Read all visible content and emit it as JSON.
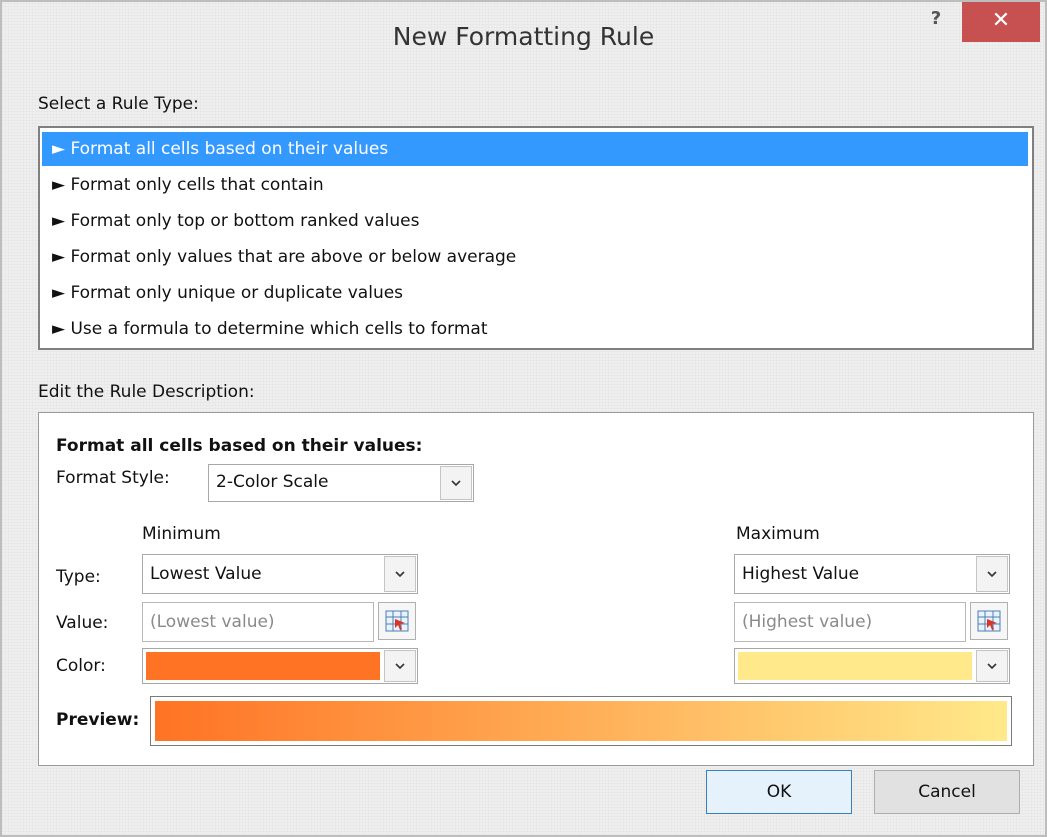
{
  "dialog": {
    "title": "New Formatting Rule",
    "help_label": "?",
    "close_label": "✕"
  },
  "rule_type": {
    "label": "Select a Rule Type:",
    "items": [
      {
        "label": "► Format all cells based on their values",
        "selected": true
      },
      {
        "label": "► Format only cells that contain",
        "selected": false
      },
      {
        "label": "► Format only top or bottom ranked values",
        "selected": false
      },
      {
        "label": "► Format only values that are above or below average",
        "selected": false
      },
      {
        "label": "► Format only unique or duplicate values",
        "selected": false
      },
      {
        "label": "► Use a formula to determine which cells to format",
        "selected": false
      }
    ]
  },
  "description": {
    "label": "Edit the Rule Description:",
    "heading": "Format all cells based on their values:",
    "format_style_label": "Format Style:",
    "format_style_value": "2-Color Scale",
    "minimum_header": "Minimum",
    "maximum_header": "Maximum",
    "type_label": "Type:",
    "value_label": "Value:",
    "color_label": "Color:",
    "min_type": "Lowest Value",
    "max_type": "Highest Value",
    "min_value_placeholder": "(Lowest value)",
    "max_value_placeholder": "(Highest value)",
    "min_color": "#ff7324",
    "max_color": "#ffe98a",
    "preview_label": "Preview:"
  },
  "buttons": {
    "ok": "OK",
    "cancel": "Cancel"
  },
  "colors": {
    "selection": "#3399ff",
    "close_button": "#c75050"
  },
  "icons": {
    "dropdown": "chevron-down-icon",
    "cell_picker": "cell-reference-picker-icon"
  }
}
